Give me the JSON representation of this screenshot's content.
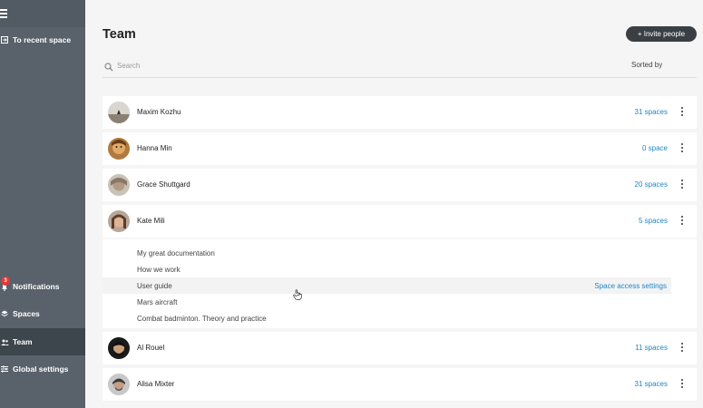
{
  "sidebar": {
    "recent_label": "To recent space",
    "notifications_label": "Notifications",
    "notifications_count": "3",
    "spaces_label": "Spaces",
    "team_label": "Team",
    "settings_label": "Global settings"
  },
  "header": {
    "title": "Team",
    "invite_label": "+ Invite people"
  },
  "search": {
    "placeholder": "Search",
    "sort_label": "Sorted by"
  },
  "members": [
    {
      "name": "Maxim Kozhu",
      "spaces": "31 spaces"
    },
    {
      "name": "Hanna Min",
      "spaces": "0 space"
    },
    {
      "name": "Grace Shuttgard",
      "spaces": "20 spaces"
    },
    {
      "name": "Kate Mili",
      "spaces": "5 spaces"
    },
    {
      "name": "Al Rouel",
      "spaces": "11 spaces"
    },
    {
      "name": "Alisa Mixter",
      "spaces": "31 spaces"
    }
  ],
  "expanded": {
    "spaces": [
      "My great documentation",
      "How we work",
      "User guide",
      "Mars aircraft",
      "Combat badminton. Theory and practice"
    ],
    "access_label": "Space access settings"
  },
  "colors": {
    "sidebar": "#59626b",
    "sidebar_active": "#3d454d",
    "accent_link": "#1e88c8",
    "invite_button": "#3a3f44",
    "badge": "#e53935"
  },
  "icons": {
    "menu": "hamburger-icon",
    "recent": "arrow-box-icon",
    "notifications": "bell-icon",
    "spaces": "layers-icon",
    "team": "people-icon",
    "settings": "sliders-icon",
    "search": "search-icon",
    "more": "kebab-icon"
  }
}
